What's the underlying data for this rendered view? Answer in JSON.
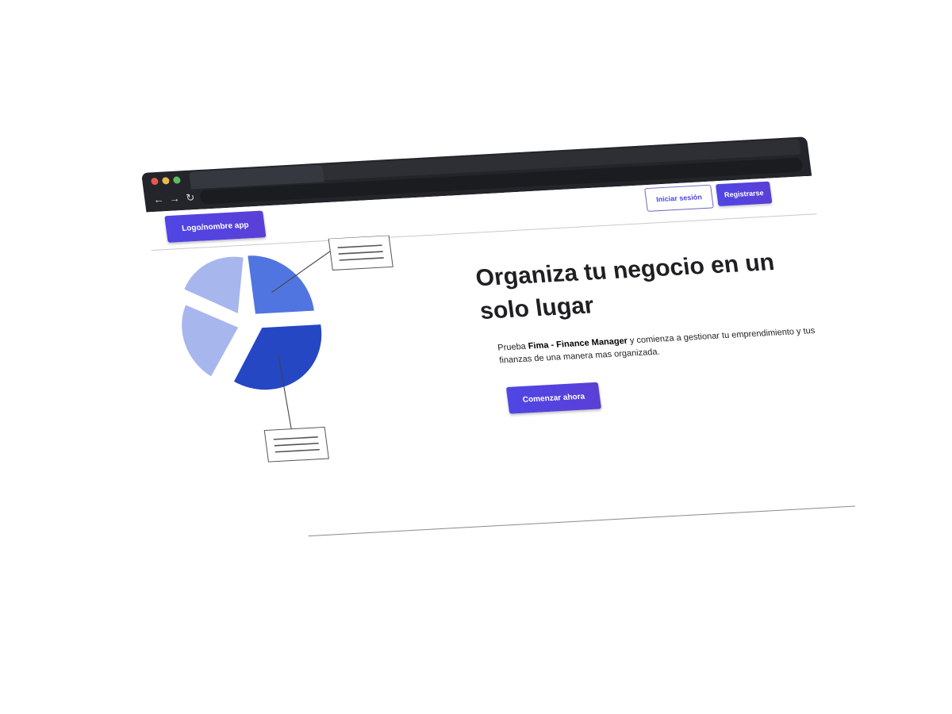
{
  "header": {
    "logo_label": "Logo/nombre app",
    "login_label": "Iniciar sesión",
    "register_label": "Registrarse"
  },
  "hero": {
    "title": "Organiza tu negocio en un solo lugar",
    "desc_prefix": "Prueba ",
    "desc_brand": "Fima - Finance Manager",
    "desc_suffix": " y comienza a gestionar tu emprendimiento y tus finanzas de una manera mas organizada.",
    "cta_label": "Comenzar ahora"
  },
  "colors": {
    "accent": "#4f46e5",
    "chart_light": "#a8b6ee",
    "chart_mid": "#5175e0",
    "chart_dark": "#2547c4"
  }
}
